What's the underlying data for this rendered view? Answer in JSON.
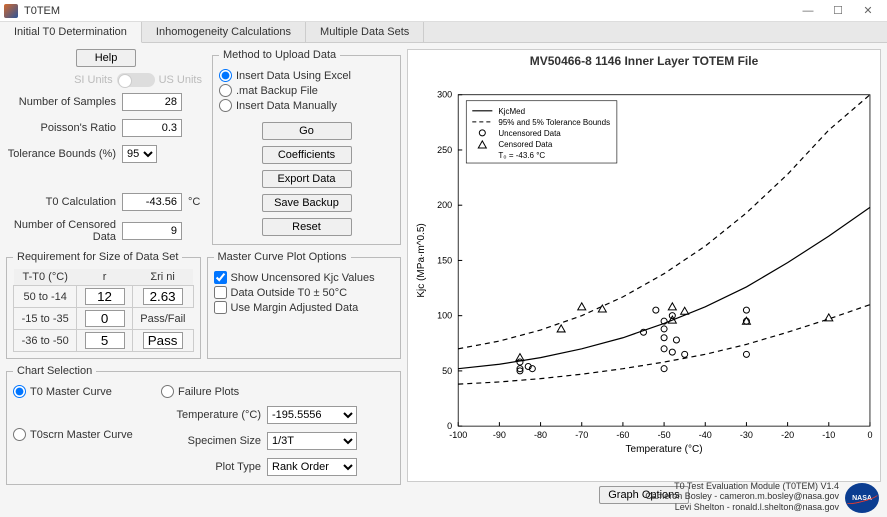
{
  "window": {
    "title": "T0TEM"
  },
  "tabs": [
    "Initial T0 Determination",
    "Inhomogeneity Calculations",
    "Multiple Data Sets"
  ],
  "help_label": "Help",
  "units": {
    "si": "SI Units",
    "us": "US Units"
  },
  "inputs": {
    "num_samples": {
      "label": "Number of Samples",
      "value": "28"
    },
    "poisson": {
      "label": "Poisson's Ratio",
      "value": "0.3"
    },
    "tol_bounds": {
      "label": "Tolerance Bounds (%)",
      "value": "95"
    },
    "t0_calc": {
      "label": "T0 Calculation",
      "value": "-43.56",
      "unit": "°C"
    },
    "censored": {
      "label": "Number of Censored Data",
      "value": "9"
    }
  },
  "upload": {
    "legend": "Method to Upload Data",
    "opt_excel": "Insert Data Using Excel",
    "opt_mat": ".mat Backup File",
    "opt_manual": "Insert Data Manually",
    "btn_go": "Go",
    "btn_coef": "Coefficients",
    "btn_export": "Export Data",
    "btn_save": "Save Backup",
    "btn_reset": "Reset"
  },
  "req": {
    "legend": "Requirement for Size of Data Set",
    "h1": "T-T0 (°C)",
    "h2": "r",
    "h3": "Σri ni",
    "r1c1": "50 to -14",
    "r1c2": "12",
    "r1val": "2.63",
    "r2c1": "-15 to -35",
    "r2c2": "0",
    "r2h": "Pass/Fail",
    "r3c1": "-36 to -50",
    "r3c2": "5",
    "r3val": "Pass"
  },
  "master_opts": {
    "legend": "Master Curve Plot Options",
    "opt_uncensored": "Show Uncensored Kjc Values",
    "opt_outside": "Data Outside T0 ± 50°C",
    "opt_margin": "Use Margin Adjusted Data"
  },
  "chart_sel": {
    "legend": "Chart Selection",
    "t0master": "T0 Master Curve",
    "failure": "Failure Plots",
    "t0scrn": "T0scrn Master Curve",
    "temp_label": "Temperature (°C)",
    "temp_val": "-195.5556",
    "spec_label": "Specimen Size",
    "spec_val": "1/3T",
    "plot_label": "Plot Type",
    "plot_val": "Rank Order"
  },
  "chart": {
    "title": "MV50466-8 1146 Inner Layer TOTEM File",
    "xlabel": "Temperature (°C)",
    "ylabel": "Kjc (MPa*m^0.5)",
    "legend": {
      "l1": "KjcMed",
      "l2": "95% and 5% Tolerance Bounds",
      "l3": "Uncensored Data",
      "l4": "Censored Data",
      "l5": "T₀ =   -43.6  °C"
    },
    "btn_graph": "Graph Options"
  },
  "credits": {
    "l1": "T0 Test Evaluation Module (T0TEM) V1.4",
    "l2": "Cameron Bosley - cameron.m.bosley@nasa.gov",
    "l3": "Levi Shelton - ronald.l.shelton@nasa.gov"
  },
  "chart_data": {
    "type": "line",
    "title": "MV50466-8 1146 Inner Layer TOTEM File",
    "xlabel": "Temperature (°C)",
    "ylabel": "Kjc (MPa*m^0.5)",
    "xlim": [
      -100,
      0
    ],
    "ylim": [
      0,
      300
    ],
    "series": [
      {
        "name": "KjcMed",
        "x": [
          -100,
          -90,
          -80,
          -70,
          -60,
          -50,
          -40,
          -30,
          -20,
          -10,
          0
        ],
        "y": [
          52,
          56,
          62,
          70,
          80,
          93,
          108,
          126,
          148,
          172,
          198
        ],
        "style": "solid"
      },
      {
        "name": "95% Bound",
        "x": [
          -100,
          -90,
          -80,
          -70,
          -60,
          -50,
          -40,
          -30,
          -20,
          -10,
          0
        ],
        "y": [
          70,
          77,
          87,
          100,
          117,
          138,
          163,
          193,
          228,
          268,
          300
        ],
        "style": "dashed"
      },
      {
        "name": "5% Bound",
        "x": [
          -100,
          -90,
          -80,
          -70,
          -60,
          -50,
          -40,
          -30,
          -20,
          -10,
          0
        ],
        "y": [
          38,
          40,
          43,
          47,
          52,
          58,
          65,
          74,
          85,
          97,
          110
        ],
        "style": "dashed"
      }
    ],
    "scatter": [
      {
        "name": "Uncensored Data",
        "marker": "circle",
        "points": [
          [
            -85,
            52
          ],
          [
            -85,
            58
          ],
          [
            -85,
            50
          ],
          [
            -83,
            54
          ],
          [
            -82,
            52
          ],
          [
            -55,
            85
          ],
          [
            -52,
            105
          ],
          [
            -50,
            80
          ],
          [
            -50,
            88
          ],
          [
            -50,
            95
          ],
          [
            -50,
            70
          ],
          [
            -50,
            52
          ],
          [
            -48,
            67
          ],
          [
            -48,
            100
          ],
          [
            -47,
            78
          ],
          [
            -45,
            65
          ],
          [
            -30,
            95
          ],
          [
            -30,
            65
          ],
          [
            -30,
            105
          ]
        ]
      },
      {
        "name": "Censored Data",
        "marker": "triangle",
        "points": [
          [
            -85,
            62
          ],
          [
            -75,
            88
          ],
          [
            -70,
            108
          ],
          [
            -65,
            106
          ],
          [
            -48,
            108
          ],
          [
            -48,
            96
          ],
          [
            -45,
            104
          ],
          [
            -30,
            95
          ],
          [
            -10,
            98
          ]
        ]
      }
    ]
  }
}
